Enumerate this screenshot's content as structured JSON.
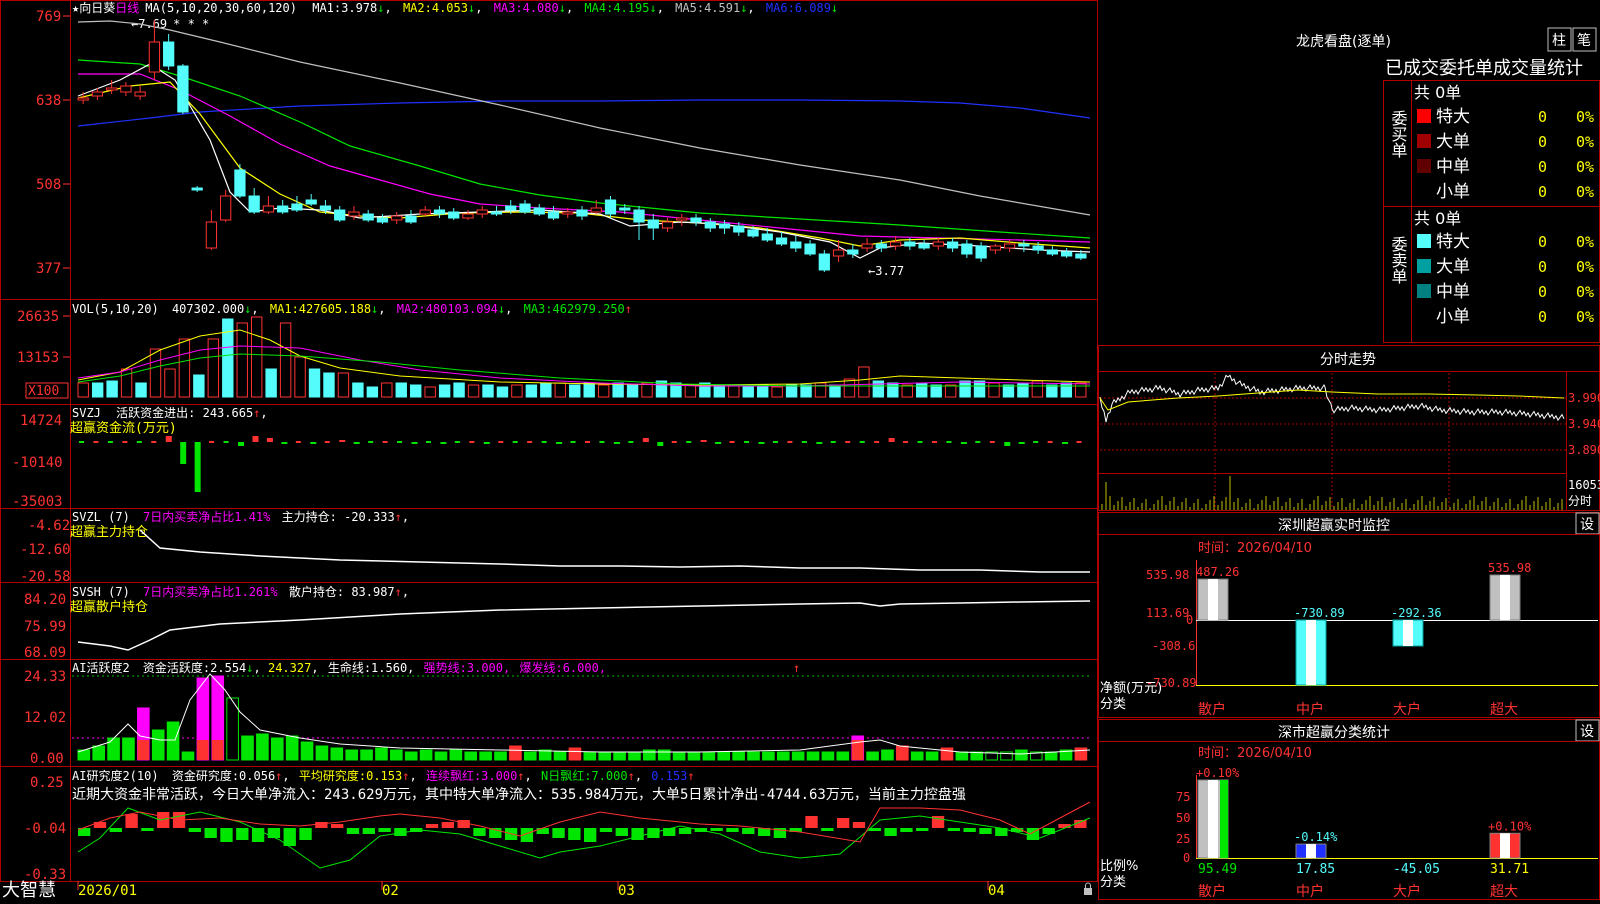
{
  "colors": {
    "up": "#ff3232",
    "down": "#54fcfc",
    "frame": "#b00000",
    "axis_text": "#ff3232",
    "white": "#ffffff",
    "yellow": "#ffff00",
    "magenta": "#ff00ff",
    "green": "#00e600",
    "blue": "#2030ff",
    "gray": "#c0c0c0"
  },
  "price_panel": {
    "title_star": "★",
    "stock_name": "向日葵",
    "period": "日线",
    "ma_header": "MA(5,10,20,30,60,120)",
    "ma_items": [
      {
        "label": "MA1:",
        "value": "3.978",
        "arrow": "↓",
        "color": "#ffffff"
      },
      {
        "label": "MA2:",
        "value": "4.053",
        "arrow": "↓",
        "color": "#ffff00"
      },
      {
        "label": "MA3:",
        "value": "4.080",
        "arrow": "↓",
        "color": "#ff00ff"
      },
      {
        "label": "MA4:",
        "value": "4.195",
        "arrow": "↓",
        "color": "#00e600"
      },
      {
        "label": "MA5:",
        "value": "4.591",
        "arrow": "↓",
        "color": "#c0c0c0"
      },
      {
        "label": "MA6:",
        "value": "6.089",
        "arrow": "↓",
        "color": "#2030ff"
      }
    ],
    "y_ticks": [
      "769",
      "638",
      "508",
      "377"
    ],
    "high_label": "7.69",
    "high_marks": "* * *",
    "low_label": "3.77"
  },
  "vol_panel": {
    "header": "VOL(5,10,20)",
    "value": "407302.000",
    "value_arrow": "↓",
    "ma_items": [
      {
        "label": "MA1:",
        "value": "427605.188",
        "arrow": "↓",
        "color": "#ffff00"
      },
      {
        "label": "MA2:",
        "value": "480103.094",
        "arrow": "↓",
        "color": "#ff00ff"
      },
      {
        "label": "MA3:",
        "value": "462979.250",
        "arrow": "↑",
        "color": "#00e600"
      }
    ],
    "y_ticks": [
      "26635",
      "13153"
    ],
    "unit_box": "X100"
  },
  "svzj_panel": {
    "header": "SVZJ",
    "label": "活跃资金进出:",
    "value": "243.665",
    "arrow": "↑",
    "sub_label": "超赢资金流(万元)",
    "y_ticks": [
      "14724",
      "-10140",
      "-35003"
    ]
  },
  "svzl_panel": {
    "header": "SVZL (7)",
    "ratio_text": "7日内买卖净占比1.41%",
    "label": "主力持仓:",
    "value": "-20.333",
    "arrow": "↑",
    "sub_label": "超赢主力持仓",
    "y_ticks": [
      "-4.62",
      "-12.60",
      "-20.58"
    ]
  },
  "svsh_panel": {
    "header": "SVSH (7)",
    "ratio_text": "7日内买卖净占比1.261%",
    "label": "散户持仓:",
    "value": "83.987",
    "arrow": "↑",
    "sub_label": "超赢散户持仓",
    "y_ticks": [
      "84.20",
      "75.99",
      "68.09"
    ]
  },
  "ai_active_panel": {
    "header": "AI活跃度2",
    "items": [
      {
        "label": "资金活跃度:",
        "value": "2.554",
        "arrow": "↓",
        "color": "#ffffff"
      },
      {
        "label": "",
        "value": "24.327",
        "arrow": ",",
        "color": "#ffff00"
      },
      {
        "label": "生命线:",
        "value": "1.560",
        "arrow": ",",
        "color": "#ffffff"
      },
      {
        "label": "强势线:",
        "value": "3.000",
        "arrow": ",",
        "color": "#ff00ff"
      },
      {
        "label": "爆发线:",
        "value": "6.000",
        "arrow": ",",
        "color": "#ff00ff"
      }
    ],
    "y_ticks": [
      "24.33",
      "12.02",
      "0.00"
    ]
  },
  "ai_research_panel": {
    "header": "AI研究度2(10)",
    "items": [
      {
        "label": "资金研究度:",
        "value": "0.056",
        "arrow": "↑",
        "color": "#ffffff"
      },
      {
        "label": "平均研究度:",
        "value": "0.153",
        "arrow": "↑",
        "color": "#ffff00"
      },
      {
        "label": "连续飘红:",
        "value": "3.000",
        "arrow": "↑",
        "color": "#ff00ff"
      },
      {
        "label": "N日飘红:",
        "value": "7.000",
        "arrow": "↑",
        "color": "#00e600"
      },
      {
        "label": "",
        "value": "0.153",
        "arrow": "↑",
        "color": "#2030ff"
      }
    ],
    "summary": "近期大资金非常活跃，今日大单净流入：243.629万元，其中特大单净流入：535.984万元，大单5日累计净出-4744.63万元，当前主力控盘强",
    "y_ticks": [
      "0.25",
      "-0.04",
      "-0.33"
    ]
  },
  "time_axis": {
    "labels": [
      "2026/01",
      "02",
      "03",
      "04"
    ],
    "logo": "大智慧",
    "lock_icon": "lock-icon"
  },
  "dragon_tiger": {
    "title": "龙虎看盘(逐单)",
    "btn_column": "柱",
    "btn_stroke": "笔",
    "header": "已成交委托单成交量统计",
    "buy_side": "委买单",
    "sell_side": "委卖单",
    "buy_total": "共 0单",
    "sell_total": "共 0单",
    "buy_rows": [
      {
        "label": "特大",
        "count": "0",
        "pct": "0%",
        "color": "#ff0000"
      },
      {
        "label": "大单",
        "count": "0",
        "pct": "0%",
        "color": "#a00000"
      },
      {
        "label": "中单",
        "count": "0",
        "pct": "0%",
        "color": "#600000"
      },
      {
        "label": "小单",
        "count": "0",
        "pct": "0%",
        "color": ""
      }
    ],
    "sell_rows": [
      {
        "label": "特大",
        "count": "0",
        "pct": "0%",
        "color": "#54fcfc"
      },
      {
        "label": "大单",
        "count": "0",
        "pct": "0%",
        "color": "#00a0a0"
      },
      {
        "label": "中单",
        "count": "0",
        "pct": "0%",
        "color": "#008080"
      },
      {
        "label": "小单",
        "count": "0",
        "pct": "0%",
        "color": ""
      }
    ]
  },
  "intraday": {
    "title": "分时走势",
    "y_ticks": [
      "3.990",
      "3.940",
      "3.890"
    ],
    "vol_tick": "16053",
    "vol_label": "分时"
  },
  "sz_monitor": {
    "title": "深圳超赢实时监控",
    "settings": "设",
    "time_text": "时间：2026/04/10",
    "y_ticks": [
      "535.98",
      "113.69",
      "0",
      "-308.6",
      "-730.89"
    ],
    "y_caption": "净额(万元)",
    "x_caption": "分类",
    "categories": [
      "散户",
      "中户",
      "大户",
      "超大"
    ],
    "values": [
      487.26,
      -730.89,
      -292.36,
      535.98
    ],
    "value_labels": [
      "487.26",
      "-730.89",
      "-292.36",
      "535.98"
    ]
  },
  "sz_category": {
    "title": "深市超赢分类统计",
    "settings": "设",
    "time_text": "时间：2026/04/10",
    "y_ticks": [
      "75",
      "50",
      "25",
      "0"
    ],
    "y_caption": "比例%",
    "x_caption": "分类",
    "categories": [
      "散户",
      "中户",
      "大户",
      "超大"
    ],
    "bar_values": [
      100,
      17.85,
      0,
      31.71
    ],
    "bar_labels": [
      "+0.10%",
      "-0.14%",
      "",
      "+0.10%"
    ],
    "bottom_values": [
      "95.49",
      "17.85",
      "-45.05",
      "31.71"
    ]
  }
}
